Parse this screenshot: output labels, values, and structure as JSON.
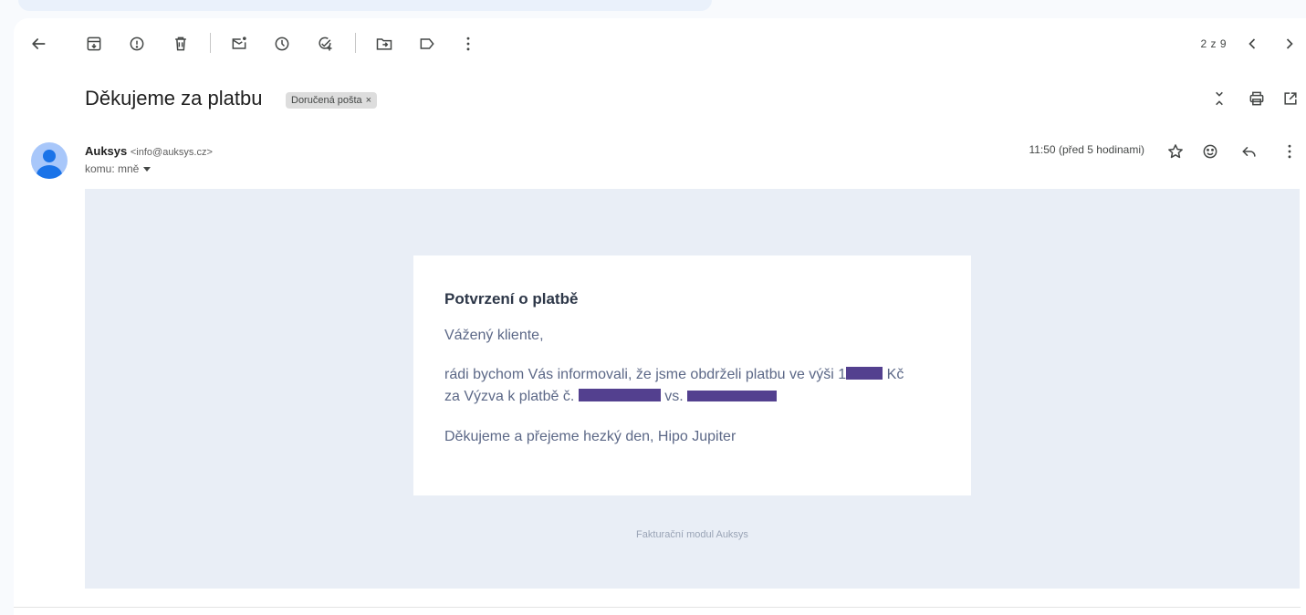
{
  "toolbar": {
    "back_icon": "arrow-left-icon",
    "actions": [
      "archive-icon",
      "report-spam-icon",
      "delete-icon",
      "mark-unread-icon",
      "snooze-icon",
      "add-task-icon",
      "move-to-icon",
      "label-icon",
      "more-vert-icon"
    ],
    "counter": "2 z 9"
  },
  "message": {
    "subject": "Děkujeme za platbu",
    "label": "Doručená pošta",
    "label_remove": "×",
    "sender_name": "Auksys",
    "sender_email": "<info@auksys.cz>",
    "to": "komu: mně",
    "time": "11:50 (před 5 hodinami)"
  },
  "email": {
    "title": "Potvrzení o platbě",
    "greeting": "Vážený kliente,",
    "p1_start": "rádi bychom Vás informovali, že jsme obdrželi platbu ve výši 1",
    "p1_currency": "Kč",
    "p2_start": "za Výzva k platbě č.",
    "p2_vs": "vs.",
    "closing": "Děkujeme a přejeme hezký den, Hipo Jupiter",
    "footer": "Fakturační modul Auksys"
  },
  "colors": {
    "redaction": "#53408f",
    "email_background": "#e9eef6",
    "avatar": "#a8c7fa"
  }
}
